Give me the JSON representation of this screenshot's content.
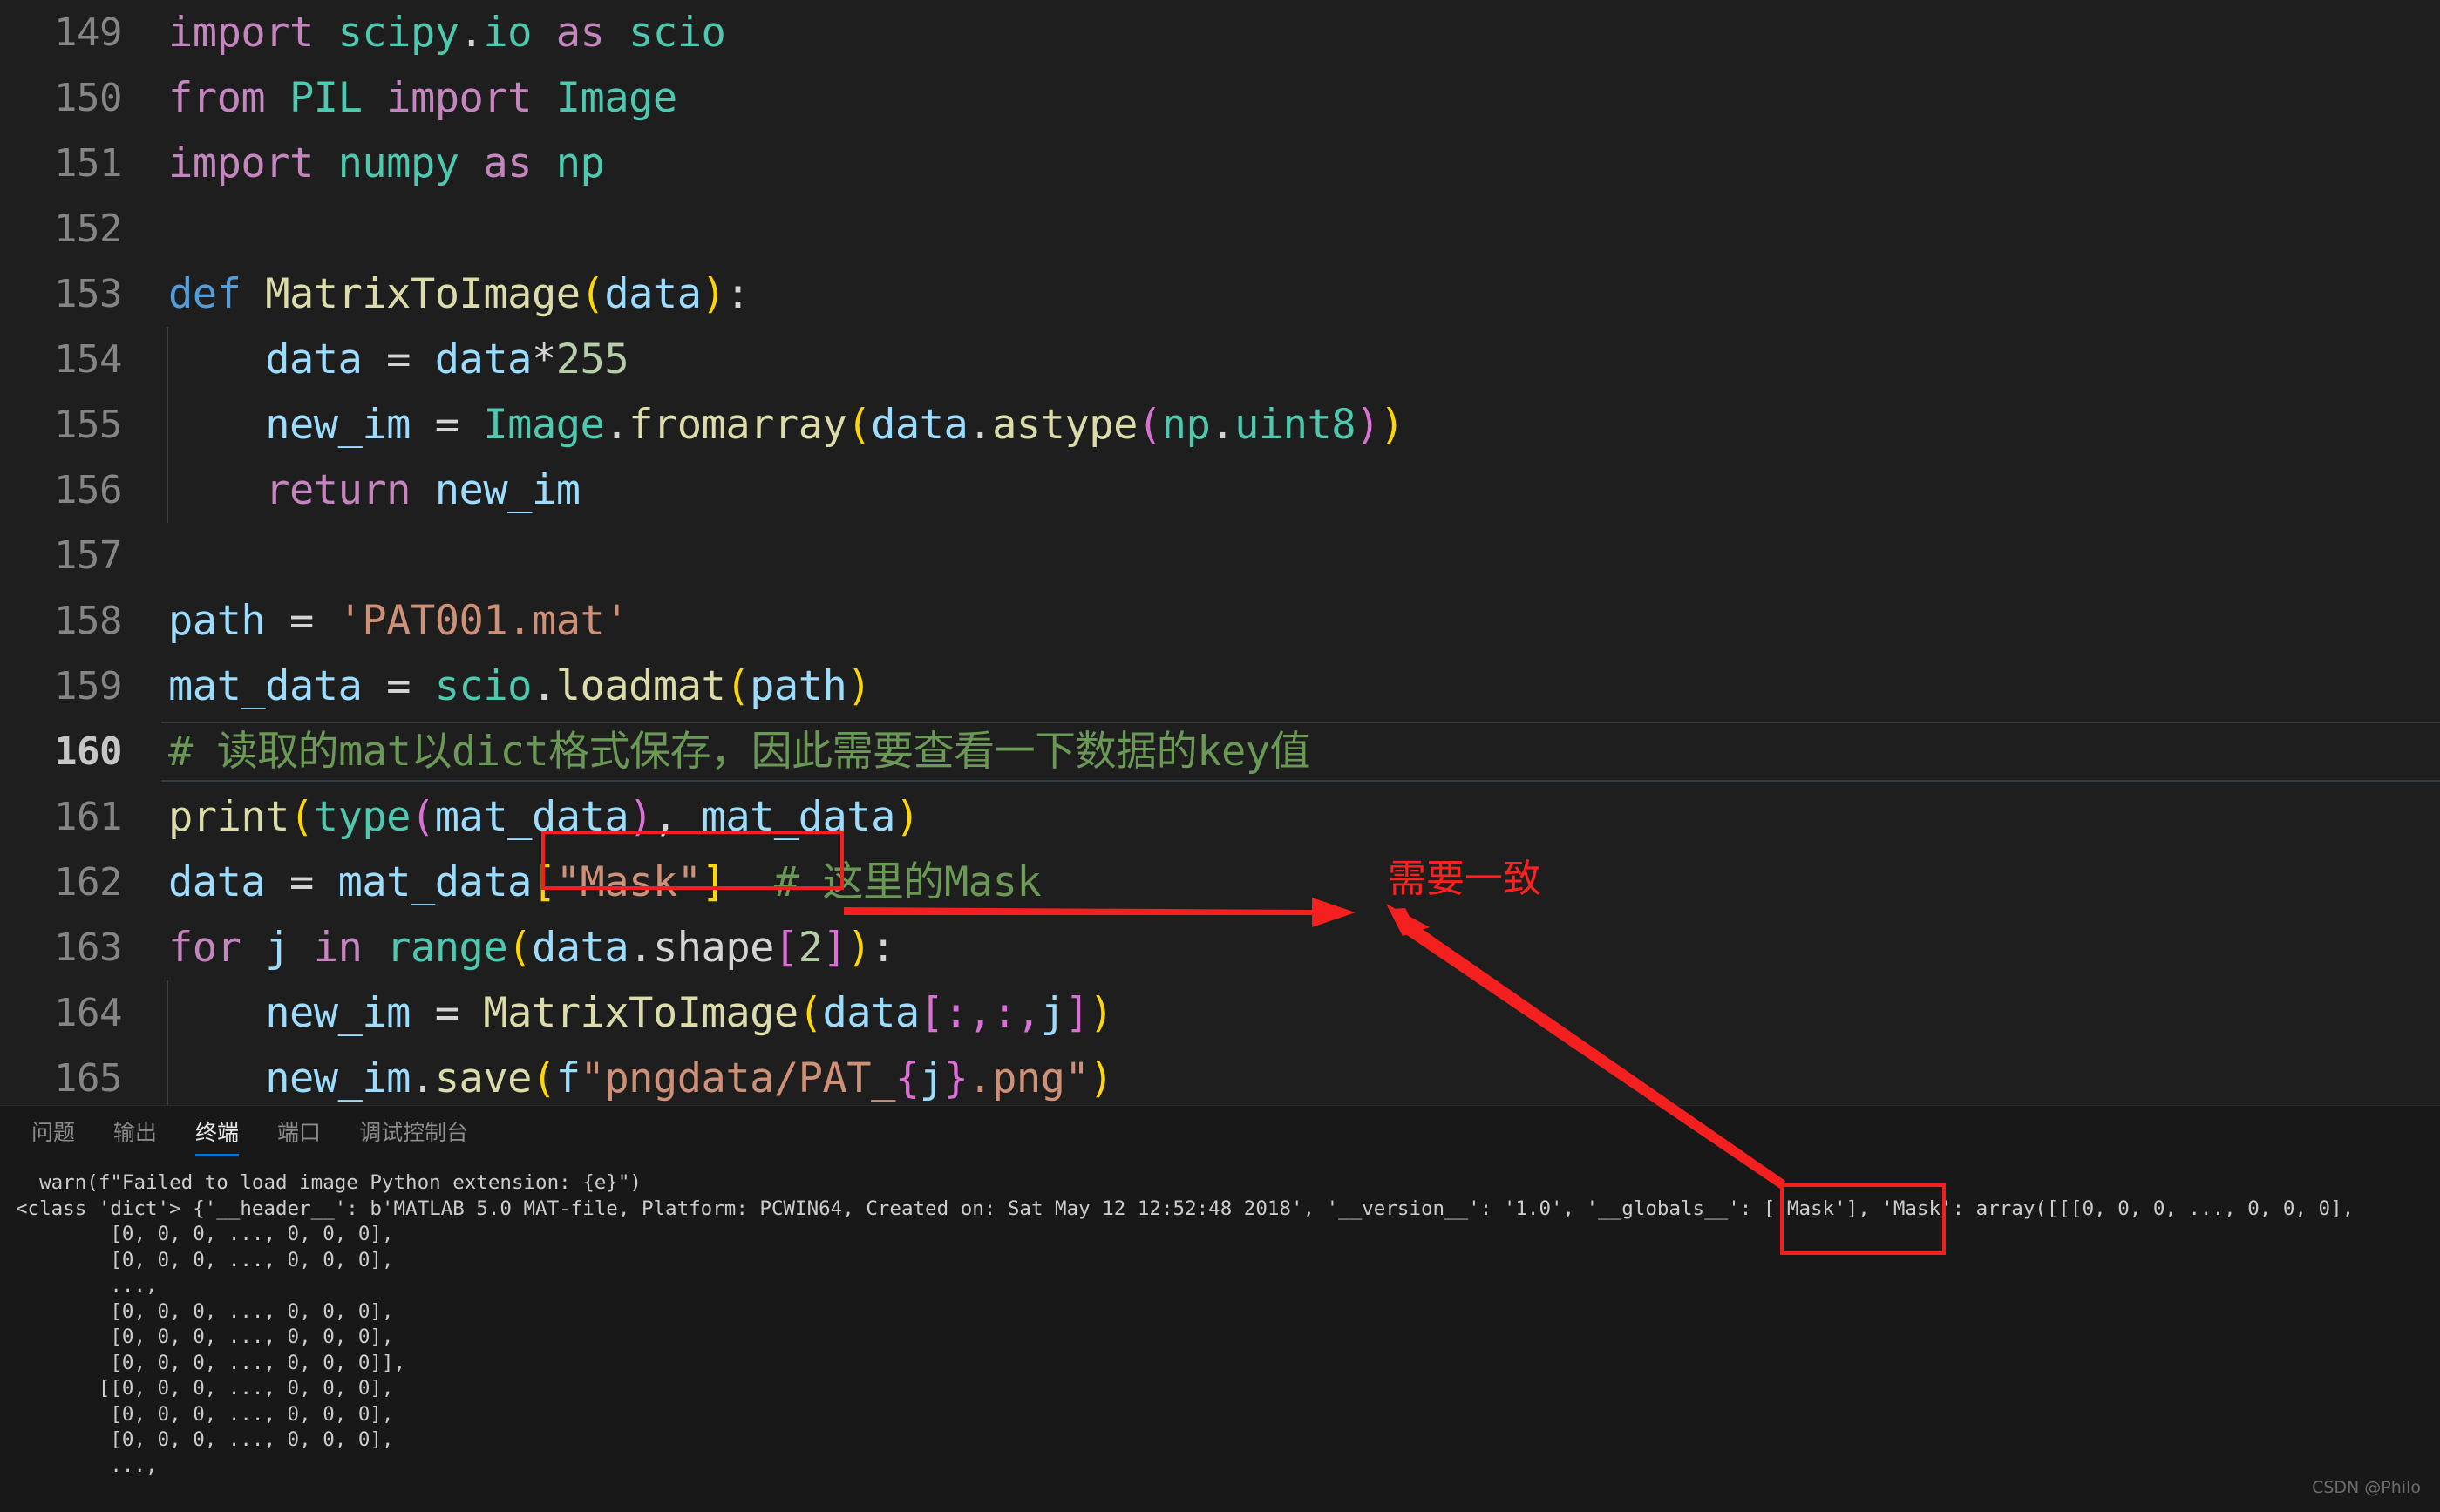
{
  "editor": {
    "lines": [
      {
        "num": "149",
        "current": false,
        "indent_guide": false,
        "tokens": [
          {
            "t": "import",
            "c": "t-kw"
          },
          {
            "t": " ",
            "c": "t-white"
          },
          {
            "t": "scipy",
            "c": "t-mod"
          },
          {
            "t": ".",
            "c": "t-white"
          },
          {
            "t": "io",
            "c": "t-mod"
          },
          {
            "t": " ",
            "c": "t-white"
          },
          {
            "t": "as",
            "c": "t-kw"
          },
          {
            "t": " ",
            "c": "t-white"
          },
          {
            "t": "scio",
            "c": "t-mod"
          }
        ]
      },
      {
        "num": "150",
        "current": false,
        "indent_guide": false,
        "tokens": [
          {
            "t": "from",
            "c": "t-kw"
          },
          {
            "t": " ",
            "c": "t-white"
          },
          {
            "t": "PIL",
            "c": "t-mod"
          },
          {
            "t": " ",
            "c": "t-white"
          },
          {
            "t": "import",
            "c": "t-kw"
          },
          {
            "t": " ",
            "c": "t-white"
          },
          {
            "t": "Image",
            "c": "t-mod"
          }
        ]
      },
      {
        "num": "151",
        "current": false,
        "indent_guide": false,
        "tokens": [
          {
            "t": "import",
            "c": "t-kw"
          },
          {
            "t": " ",
            "c": "t-white"
          },
          {
            "t": "numpy",
            "c": "t-mod"
          },
          {
            "t": " ",
            "c": "t-white"
          },
          {
            "t": "as",
            "c": "t-kw"
          },
          {
            "t": " ",
            "c": "t-white"
          },
          {
            "t": "np",
            "c": "t-mod"
          }
        ]
      },
      {
        "num": "152",
        "current": false,
        "indent_guide": false,
        "tokens": []
      },
      {
        "num": "153",
        "current": false,
        "indent_guide": false,
        "tokens": [
          {
            "t": "def",
            "c": "t-kw2"
          },
          {
            "t": " ",
            "c": "t-white"
          },
          {
            "t": "MatrixToImage",
            "c": "t-fn"
          },
          {
            "t": "(",
            "c": "t-p1"
          },
          {
            "t": "data",
            "c": "t-var"
          },
          {
            "t": ")",
            "c": "t-p1"
          },
          {
            "t": ":",
            "c": "t-white"
          }
        ]
      },
      {
        "num": "154",
        "current": false,
        "indent_guide": true,
        "tokens": [
          {
            "t": "    ",
            "c": "t-white"
          },
          {
            "t": "data",
            "c": "t-var"
          },
          {
            "t": " ",
            "c": "t-white"
          },
          {
            "t": "=",
            "c": "t-op"
          },
          {
            "t": " ",
            "c": "t-white"
          },
          {
            "t": "data",
            "c": "t-var"
          },
          {
            "t": "*",
            "c": "t-op"
          },
          {
            "t": "255",
            "c": "t-num"
          }
        ]
      },
      {
        "num": "155",
        "current": false,
        "indent_guide": true,
        "tokens": [
          {
            "t": "    ",
            "c": "t-white"
          },
          {
            "t": "new_im",
            "c": "t-var"
          },
          {
            "t": " ",
            "c": "t-white"
          },
          {
            "t": "=",
            "c": "t-op"
          },
          {
            "t": " ",
            "c": "t-white"
          },
          {
            "t": "Image",
            "c": "t-mod"
          },
          {
            "t": ".",
            "c": "t-white"
          },
          {
            "t": "fromarray",
            "c": "t-fn"
          },
          {
            "t": "(",
            "c": "t-p1"
          },
          {
            "t": "data",
            "c": "t-var"
          },
          {
            "t": ".",
            "c": "t-white"
          },
          {
            "t": "astype",
            "c": "t-fn"
          },
          {
            "t": "(",
            "c": "t-p2"
          },
          {
            "t": "np",
            "c": "t-mod"
          },
          {
            "t": ".",
            "c": "t-white"
          },
          {
            "t": "uint8",
            "c": "t-mod"
          },
          {
            "t": ")",
            "c": "t-p2"
          },
          {
            "t": ")",
            "c": "t-p1"
          }
        ]
      },
      {
        "num": "156",
        "current": false,
        "indent_guide": true,
        "tokens": [
          {
            "t": "    ",
            "c": "t-white"
          },
          {
            "t": "return",
            "c": "t-kw"
          },
          {
            "t": " ",
            "c": "t-white"
          },
          {
            "t": "new_im",
            "c": "t-var"
          }
        ]
      },
      {
        "num": "157",
        "current": false,
        "indent_guide": false,
        "tokens": []
      },
      {
        "num": "158",
        "current": false,
        "indent_guide": false,
        "tokens": [
          {
            "t": "path",
            "c": "t-var"
          },
          {
            "t": " ",
            "c": "t-white"
          },
          {
            "t": "=",
            "c": "t-op"
          },
          {
            "t": " ",
            "c": "t-white"
          },
          {
            "t": "'PAT001.mat'",
            "c": "t-str"
          }
        ]
      },
      {
        "num": "159",
        "current": false,
        "indent_guide": false,
        "tokens": [
          {
            "t": "mat_data",
            "c": "t-var"
          },
          {
            "t": " ",
            "c": "t-white"
          },
          {
            "t": "=",
            "c": "t-op"
          },
          {
            "t": " ",
            "c": "t-white"
          },
          {
            "t": "scio",
            "c": "t-mod"
          },
          {
            "t": ".",
            "c": "t-white"
          },
          {
            "t": "loadmat",
            "c": "t-fn"
          },
          {
            "t": "(",
            "c": "t-p1"
          },
          {
            "t": "path",
            "c": "t-var"
          },
          {
            "t": ")",
            "c": "t-p1"
          }
        ]
      },
      {
        "num": "160",
        "current": true,
        "indent_guide": false,
        "tokens": [
          {
            "t": "# 读取的mat以dict格式保存，因此需要查看一下数据的key值",
            "c": "t-cmt"
          }
        ]
      },
      {
        "num": "161",
        "current": false,
        "indent_guide": false,
        "tokens": [
          {
            "t": "print",
            "c": "t-fn"
          },
          {
            "t": "(",
            "c": "t-p1"
          },
          {
            "t": "type",
            "c": "t-mod"
          },
          {
            "t": "(",
            "c": "t-p2"
          },
          {
            "t": "mat_data",
            "c": "t-var"
          },
          {
            "t": ")",
            "c": "t-p2"
          },
          {
            "t": ", ",
            "c": "t-white"
          },
          {
            "t": "mat_data",
            "c": "t-var"
          },
          {
            "t": ")",
            "c": "t-p1"
          }
        ]
      },
      {
        "num": "162",
        "current": false,
        "indent_guide": false,
        "tokens": [
          {
            "t": "data",
            "c": "t-var"
          },
          {
            "t": " ",
            "c": "t-white"
          },
          {
            "t": "=",
            "c": "t-op"
          },
          {
            "t": " ",
            "c": "t-white"
          },
          {
            "t": "mat_data",
            "c": "t-var"
          },
          {
            "t": "[",
            "c": "t-p1"
          },
          {
            "t": "\"Mask\"",
            "c": "t-str"
          },
          {
            "t": "]",
            "c": "t-p1"
          },
          {
            "t": "  ",
            "c": "t-white"
          },
          {
            "t": "# 这里的Mask",
            "c": "t-cmt"
          }
        ]
      },
      {
        "num": "163",
        "current": false,
        "indent_guide": false,
        "tokens": [
          {
            "t": "for",
            "c": "t-kw"
          },
          {
            "t": " ",
            "c": "t-white"
          },
          {
            "t": "j",
            "c": "t-var"
          },
          {
            "t": " ",
            "c": "t-white"
          },
          {
            "t": "in",
            "c": "t-kw"
          },
          {
            "t": " ",
            "c": "t-white"
          },
          {
            "t": "range",
            "c": "t-mod"
          },
          {
            "t": "(",
            "c": "t-p1"
          },
          {
            "t": "data",
            "c": "t-var"
          },
          {
            "t": ".",
            "c": "t-white"
          },
          {
            "t": "shape",
            "c": "t-op"
          },
          {
            "t": "[",
            "c": "t-p2"
          },
          {
            "t": "2",
            "c": "t-num"
          },
          {
            "t": "]",
            "c": "t-p2"
          },
          {
            "t": ")",
            "c": "t-p1"
          },
          {
            "t": ":",
            "c": "t-white"
          }
        ]
      },
      {
        "num": "164",
        "current": false,
        "indent_guide": true,
        "tokens": [
          {
            "t": "    ",
            "c": "t-white"
          },
          {
            "t": "new_im",
            "c": "t-var"
          },
          {
            "t": " ",
            "c": "t-white"
          },
          {
            "t": "=",
            "c": "t-op"
          },
          {
            "t": " ",
            "c": "t-white"
          },
          {
            "t": "MatrixToImage",
            "c": "t-fn"
          },
          {
            "t": "(",
            "c": "t-p1"
          },
          {
            "t": "data",
            "c": "t-var"
          },
          {
            "t": "[",
            "c": "t-p2"
          },
          {
            "t": ":,:,",
            "c": "t-p2"
          },
          {
            "t": "j",
            "c": "t-var"
          },
          {
            "t": "]",
            "c": "t-p2"
          },
          {
            "t": ")",
            "c": "t-p1"
          }
        ]
      },
      {
        "num": "165",
        "current": false,
        "indent_guide": true,
        "tokens": [
          {
            "t": "    ",
            "c": "t-white"
          },
          {
            "t": "new_im",
            "c": "t-var"
          },
          {
            "t": ".",
            "c": "t-white"
          },
          {
            "t": "save",
            "c": "t-fn"
          },
          {
            "t": "(",
            "c": "t-p1"
          },
          {
            "t": "f",
            "c": "t-var"
          },
          {
            "t": "\"pngdata/PAT_",
            "c": "t-str"
          },
          {
            "t": "{",
            "c": "t-p2"
          },
          {
            "t": "j",
            "c": "t-var"
          },
          {
            "t": "}",
            "c": "t-p2"
          },
          {
            "t": ".png\"",
            "c": "t-str"
          },
          {
            "t": ")",
            "c": "t-p1"
          }
        ]
      }
    ]
  },
  "annotations": {
    "label_need_match": "需要一致",
    "box_color": "#f42020",
    "arrow_color": "#f42020"
  },
  "panel": {
    "tabs": [
      {
        "label": "问题",
        "active": false
      },
      {
        "label": "输出",
        "active": false
      },
      {
        "label": "终端",
        "active": true
      },
      {
        "label": "端口",
        "active": false
      },
      {
        "label": "调试控制台",
        "active": false
      }
    ],
    "terminal_lines": [
      "  warn(f\"Failed to load image Python extension: {e}\")",
      "<class 'dict'> {'__header__': b'MATLAB 5.0 MAT-file, Platform: PCWIN64, Created on: Sat May 12 12:52:48 2018', '__version__': '1.0', '__globals__': ['Mask'], 'Mask': array([[[0, 0, 0, ..., 0, 0, 0],",
      "        [0, 0, 0, ..., 0, 0, 0],",
      "        [0, 0, 0, ..., 0, 0, 0],",
      "        ...,",
      "        [0, 0, 0, ..., 0, 0, 0],",
      "        [0, 0, 0, ..., 0, 0, 0],",
      "        [0, 0, 0, ..., 0, 0, 0]],",
      "",
      "       [[0, 0, 0, ..., 0, 0, 0],",
      "        [0, 0, 0, ..., 0, 0, 0],",
      "        [0, 0, 0, ..., 0, 0, 0],",
      "        ...,"
    ]
  },
  "watermark": {
    "text": "CSDN @Philo"
  }
}
